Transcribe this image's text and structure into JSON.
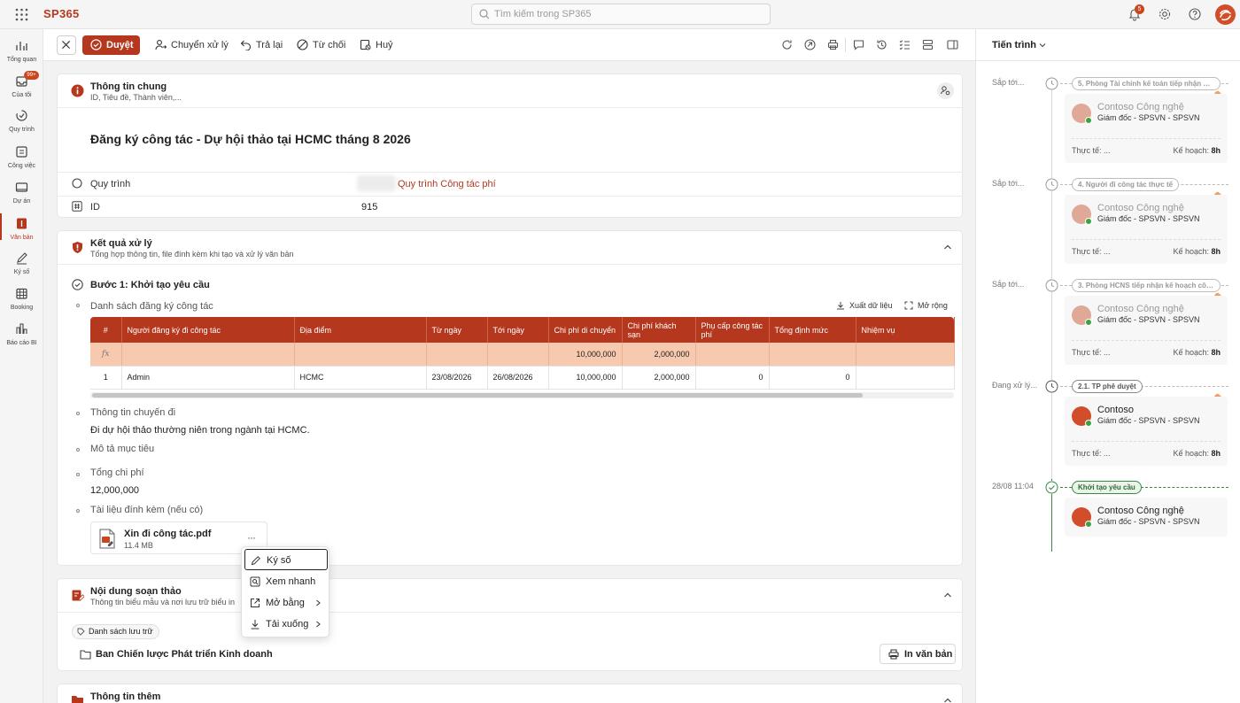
{
  "app": {
    "brand": "SP365",
    "search_placeholder": "Tìm kiếm trong SP365",
    "notification_count": "5"
  },
  "sidebar": {
    "items": [
      {
        "label": "Tổng quan",
        "icon": "bar-chart-icon"
      },
      {
        "label": "Của tôi",
        "icon": "inbox-icon",
        "badge": "99+"
      },
      {
        "label": "Quy trình",
        "icon": "workflow-icon"
      },
      {
        "label": "Công việc",
        "icon": "tasks-icon"
      },
      {
        "label": "Dự án",
        "icon": "project-icon"
      },
      {
        "label": "Văn bản",
        "icon": "document-icon",
        "active": true
      },
      {
        "label": "Ký số",
        "icon": "signature-icon"
      },
      {
        "label": "Booking",
        "icon": "calendar-icon"
      },
      {
        "label": "Báo cáo BI",
        "icon": "report-icon"
      }
    ]
  },
  "toolbar": {
    "approve": "Duyệt",
    "forward": "Chuyển xử lý",
    "return": "Trả lại",
    "reject": "Từ chối",
    "cancel": "Huỷ"
  },
  "general_info": {
    "title": "Thông tin chung",
    "subtitle": "ID, Tiêu đề, Thành viên,...",
    "doc_title": "Đăng ký công tác - Dự hội thảo tại HCMC tháng 8 2026",
    "process_label": "Quy trình",
    "process_value": "Quy trình Công tác phí",
    "id_label": "ID",
    "id_value": "915"
  },
  "result": {
    "title": "Kết quả xử lý",
    "subtitle": "Tổng hợp thông tin, file đính kèm khi tạo và xử lý văn bản",
    "step_title": "Bước 1: Khởi tạo yêu cầu",
    "list_label": "Danh sách đăng ký công tác",
    "export_label": "Xuất dữ liệu",
    "expand_label": "Mở rộng",
    "table": {
      "headers": [
        "#",
        "Người đăng ký đi công tác",
        "Địa điểm",
        "Từ ngày",
        "Tới ngày",
        "Chi phí di chuyển",
        "Chi phí khách sạn",
        "Phụ cấp công tác phí",
        "Tổng định mức",
        "Nhiệm vụ"
      ],
      "summary": {
        "symbol": "fx",
        "travel": "10,000,000",
        "hotel": "2,000,000"
      },
      "rows": [
        {
          "no": "1",
          "person": "Admin",
          "place": "HCMC",
          "from": "23/08/2026",
          "to": "26/08/2026",
          "travel": "10,000,000",
          "hotel": "2,000,000",
          "allowance": "0",
          "total": "0",
          "task": ""
        }
      ]
    },
    "trip_info_label": "Thông tin chuyến đi",
    "trip_info_value": "Đi dự hội thảo thường niên trong ngành tại HCMC.",
    "goal_label": "Mô tả mục tiêu",
    "total_cost_label": "Tổng chi phí",
    "total_cost_value": "12,000,000",
    "attachments_label": "Tài liệu đính kèm (nếu có)",
    "file": {
      "name": "Xin đi công tác.pdf",
      "size": "11.4 MB",
      "more": "···"
    }
  },
  "context_menu": {
    "items": [
      {
        "label": "Ký số",
        "selected": true
      },
      {
        "label": "Xem nhanh"
      },
      {
        "label": "Mở bằng",
        "submenu": true
      },
      {
        "label": "Tải xuống",
        "submenu": true
      }
    ]
  },
  "draft": {
    "title": "Nội dung soạn thảo",
    "subtitle": "Thông tin biểu mẫu và nơi lưu trữ biểu in",
    "chip": "Danh sách lưu trữ",
    "folder": "Ban Chiến lược Phát triển Kinh doanh",
    "print": "In văn bản"
  },
  "more_info": {
    "title": "Thông tin thêm"
  },
  "progress": {
    "title": "Tiến trình",
    "steps": [
      {
        "time": "Sắp tới...",
        "pill": "5. Phòng Tài chính kế toán tiếp nhận đề ...",
        "name": "Contoso Công nghệ",
        "role": "Giám đốc - SPSVN - SPSVN",
        "actual": "Thực tế: ...",
        "plan_label": "Kế hoạch:",
        "plan_value": "8h",
        "state": "upcoming"
      },
      {
        "time": "Sắp tới...",
        "pill": "4. Người đi công tác thực tế",
        "name": "Contoso Công nghệ",
        "role": "Giám đốc - SPSVN - SPSVN",
        "actual": "Thực tế: ...",
        "plan_label": "Kế hoạch:",
        "plan_value": "8h",
        "state": "upcoming"
      },
      {
        "time": "Sắp tới...",
        "pill": "3. Phòng HCNS tiếp nhận kế hoạch công...",
        "name": "Contoso Công nghệ",
        "role": "Giám đốc - SPSVN - SPSVN",
        "actual": "Thực tế: ...",
        "plan_label": "Kế hoạch:",
        "plan_value": "8h",
        "state": "upcoming"
      },
      {
        "time": "Đang xử lý...",
        "pill": "2.1. TP phê duyệt",
        "name": "Contoso",
        "role": "Giám đốc - SPSVN - SPSVN",
        "actual": "Thực tế: ...",
        "plan_label": "Kế hoạch:",
        "plan_value": "8h",
        "state": "active"
      },
      {
        "time": "28/08 11:04",
        "pill": "Khởi tạo yêu cầu",
        "name": "Contoso Công nghệ",
        "role": "Giám đốc - SPSVN - SPSVN",
        "state": "done"
      }
    ]
  },
  "colors": {
    "brand": "#b5381e",
    "fx_row": "#f7c9ae",
    "done": "#3a8a3f"
  }
}
